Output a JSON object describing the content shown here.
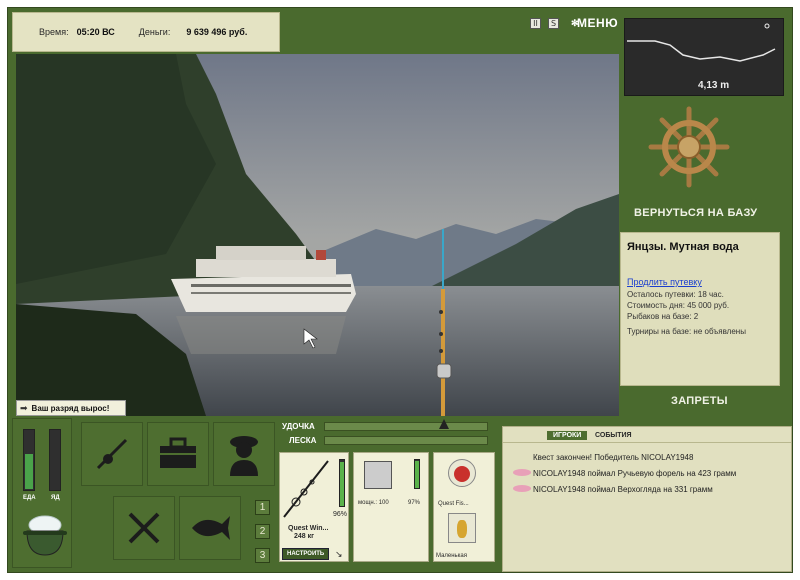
{
  "header": {
    "time_label": "Время:",
    "time_value": "05:20 ВС",
    "money_label": "Деньги:",
    "money_value": "9 639 496 руб.",
    "pause_symbol": "II",
    "sound_symbol": "S",
    "menu_label": "МЕНЮ"
  },
  "depth": {
    "value": "4,13 m"
  },
  "right": {
    "back_to_base": "ВЕРНУТЬСЯ НА БАЗУ",
    "bans": "ЗАПРЕТЫ"
  },
  "lake": {
    "title": "Янцзы. Мутная вода",
    "extend_link": "Продлить путевку",
    "remaining": "Осталось путевки: 18 час.",
    "day_cost": "Стоимость дня: 45 000 руб.",
    "fishers": "Рыбаков на базе: 2",
    "tournaments": "Турниры на базе: не объявлены"
  },
  "scene": {
    "rank_message": "Ваш разряд вырос!"
  },
  "controls": {
    "rod_label": "УДОЧКА",
    "line_label": "ЛЕСКА",
    "food_label": "ЕДА",
    "poison_label": "ЯД",
    "food_level": 0.6,
    "poison_level": 0.0,
    "slot_numbers": [
      "1",
      "2",
      "3"
    ]
  },
  "tackle": {
    "rod_name": "Quest Win...",
    "rod_weight": "248 кг",
    "rod_pct": "96%",
    "reel_label": "мощн.: 100",
    "reel_pct": "97%",
    "lure1_name": "Quest Fis...",
    "lure2_name": "Маленькая",
    "setup_button": "НАСТРОИТЬ",
    "rod_level": 0.96,
    "reel_level": 0.97
  },
  "events": {
    "tab_players": "ИГРОКИ",
    "tab_events": "СОБЫТИЯ",
    "lines": [
      "Квест закончен! Победитель NICOLAY1948",
      "NICOLAY1948 поймал Ручьевую форель на 423 грамм",
      "NICOLAY1948 поймал Верхогляда на 331 грамм"
    ]
  }
}
